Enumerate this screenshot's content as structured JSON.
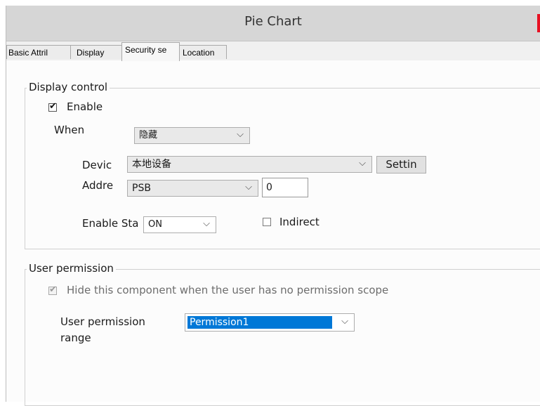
{
  "window": {
    "title": "Pie Chart"
  },
  "tabs": [
    {
      "label": "Basic Attril"
    },
    {
      "label": "Display"
    },
    {
      "label": "Security se"
    },
    {
      "label": "Location"
    }
  ],
  "display_control": {
    "legend": "Display control",
    "enable": {
      "label": "Enable",
      "checked": true
    },
    "when": {
      "label": "When",
      "value": "隐藏"
    },
    "device": {
      "label": "Devic",
      "value": "本地设备",
      "settings_label": "Settin"
    },
    "address": {
      "label": "Addre",
      "type_value": "PSB",
      "number_value": "0"
    },
    "enable_state": {
      "label": "Enable Sta",
      "value": "ON"
    },
    "indirect": {
      "label": "Indirect",
      "checked": false
    }
  },
  "user_permission": {
    "legend": "User permission",
    "hide_option": {
      "label": "Hide this component when the user has no permission scope",
      "checked": true,
      "disabled": true
    },
    "range": {
      "label_line1": "User permission",
      "label_line2": "range",
      "value": "Permission1"
    }
  },
  "colors": {
    "selection": "#0078d7",
    "close_accent": "#e81123"
  }
}
